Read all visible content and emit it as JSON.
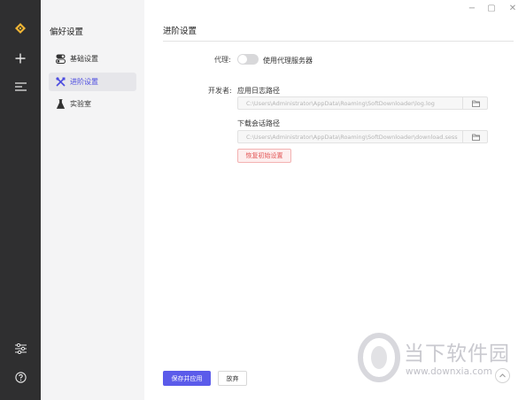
{
  "window": {
    "min_glyph": "−",
    "max_glyph": "▢",
    "close_glyph": "✕"
  },
  "rail": {
    "icons": [
      "logo-icon",
      "plus-icon",
      "menu-icon",
      "sliders-icon",
      "help-icon"
    ]
  },
  "sidebar": {
    "title": "偏好设置",
    "items": [
      {
        "label": "基础设置",
        "icon": "toggle-icon",
        "active": false
      },
      {
        "label": "进阶设置",
        "icon": "tools-icon",
        "active": true
      },
      {
        "label": "实验室",
        "icon": "flask-icon",
        "active": false
      }
    ]
  },
  "main": {
    "title": "进阶设置",
    "proxy": {
      "label": "代理:",
      "toggle_on": false,
      "text": "使用代理服务器"
    },
    "developer": {
      "label": "开发者:",
      "log_path_label": "应用日志路径",
      "log_path_value": "C:\\Users\\Administrator\\AppData\\Roaming\\SoftDownloader\\log.log",
      "session_path_label": "下载会话路径",
      "session_path_value": "C:\\Users\\Administrator\\AppData\\Roaming\\SoftDownloader\\download.sess",
      "reset_label": "恢复初始设置"
    }
  },
  "footer": {
    "save_label": "保存并应用",
    "discard_label": "放弃"
  },
  "watermark": {
    "brand": "当下软件园",
    "url": "www.downxia.com"
  },
  "colors": {
    "rail_bg": "#2f2f30",
    "sidebar_bg": "#f4f4f5",
    "accent": "#5b5bea",
    "danger": "#e25555"
  }
}
